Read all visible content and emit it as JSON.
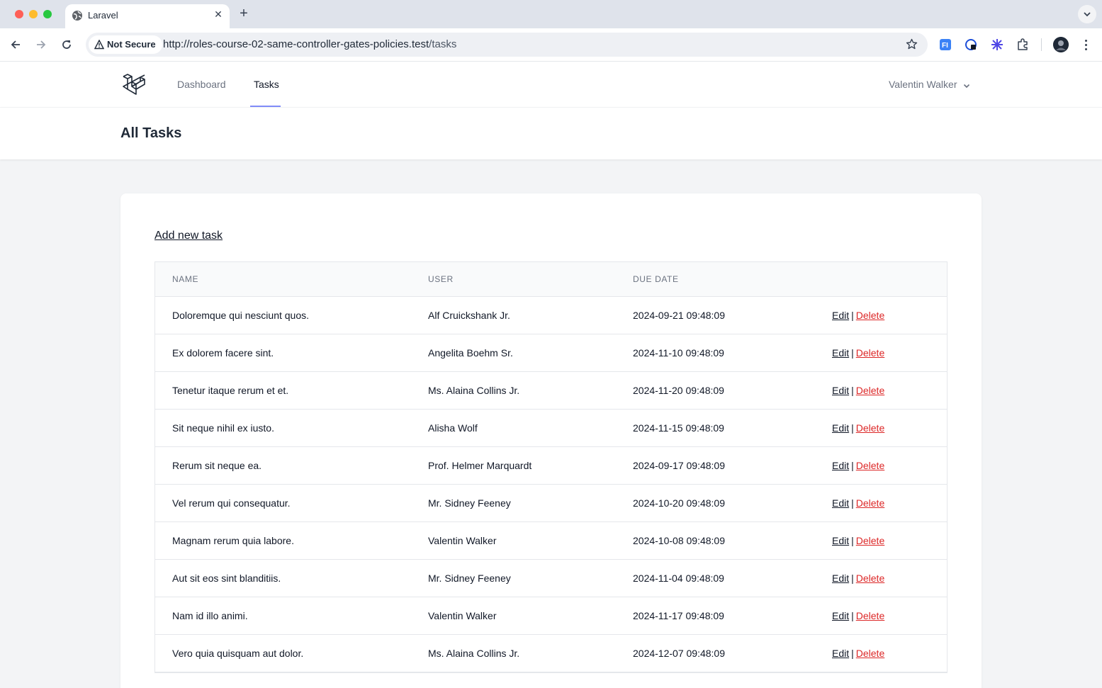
{
  "browser": {
    "tab_title": "Laravel",
    "new_tab": "+",
    "security_label": "Not Secure",
    "url_host": "http://roles-course-02-same-controller-gates-policies.test",
    "url_path": "/tasks"
  },
  "nav": {
    "links": [
      "Dashboard",
      "Tasks"
    ],
    "active": "Tasks",
    "user_name": "Valentin Walker"
  },
  "page": {
    "title": "All Tasks",
    "add_link": "Add new task"
  },
  "table": {
    "headers": [
      "NAME",
      "USER",
      "DUE DATE"
    ],
    "edit_label": "Edit",
    "separator": "|",
    "delete_label": "Delete",
    "rows": [
      {
        "name": "Doloremque qui nesciunt quos.",
        "user": "Alf Cruickshank Jr.",
        "due": "2024-09-21 09:48:09"
      },
      {
        "name": "Ex dolorem facere sint.",
        "user": "Angelita Boehm Sr.",
        "due": "2024-11-10 09:48:09"
      },
      {
        "name": "Tenetur itaque rerum et et.",
        "user": "Ms. Alaina Collins Jr.",
        "due": "2024-11-20 09:48:09"
      },
      {
        "name": "Sit neque nihil ex iusto.",
        "user": "Alisha Wolf",
        "due": "2024-11-15 09:48:09"
      },
      {
        "name": "Rerum sit neque ea.",
        "user": "Prof. Helmer Marquardt",
        "due": "2024-09-17 09:48:09"
      },
      {
        "name": "Vel rerum qui consequatur.",
        "user": "Mr. Sidney Feeney",
        "due": "2024-10-20 09:48:09"
      },
      {
        "name": "Magnam rerum quia labore.",
        "user": "Valentin Walker",
        "due": "2024-10-08 09:48:09"
      },
      {
        "name": "Aut sit eos sint blanditiis.",
        "user": "Mr. Sidney Feeney",
        "due": "2024-11-04 09:48:09"
      },
      {
        "name": "Nam id illo animi.",
        "user": "Valentin Walker",
        "due": "2024-11-17 09:48:09"
      },
      {
        "name": "Vero quia quisquam aut dolor.",
        "user": "Ms. Alaina Collins Jr.",
        "due": "2024-12-07 09:48:09"
      }
    ]
  },
  "colors": {
    "accent": "#818cf8",
    "delete": "#dc2626",
    "page_bg": "#f3f4f6"
  },
  "icons": [
    "globe-icon",
    "close-icon",
    "chevron-down-icon",
    "back-icon",
    "forward-icon",
    "reload-icon",
    "warning-icon",
    "star-icon",
    "extension-icons",
    "puzzle-icon",
    "kebab-menu-icon",
    "laravel-logo"
  ]
}
